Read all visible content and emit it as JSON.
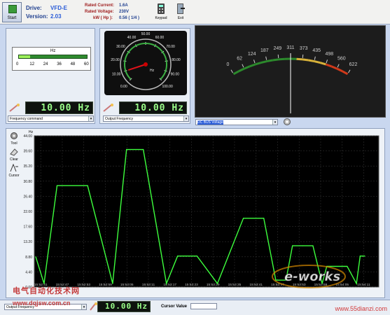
{
  "toolbar": {
    "start_label": "Start",
    "drive_label": "Drive:",
    "drive_value": "VFD-E",
    "version_label": "Version:",
    "version_value": "2.03",
    "rated_current_label": "Rated Current:",
    "rated_current_value": "1.6A",
    "rated_voltage_label": "Rated Voltage:",
    "rated_voltage_value": "230V",
    "kw_label": "kW ( Hp ):",
    "kw_value": "0.56 ( 1/4 )",
    "keypad_label": "Keypad",
    "exit_label": "Exit"
  },
  "bar_meter": {
    "unit": "Hz",
    "ticks": [
      "0",
      "12",
      "24",
      "36",
      "48",
      "60"
    ],
    "lcd_value": "10.00 Hz",
    "combo_value": "Frequency command",
    "fill_fraction": 0.17
  },
  "dial_meter": {
    "unit": "Hz",
    "ticks": [
      "0.00",
      "10.00",
      "20.00",
      "30.00",
      "40.00",
      "50.00",
      "60.00",
      "70.00",
      "80.00",
      "90.00",
      "100.00"
    ],
    "lcd_value": "10.00 Hz",
    "combo_value": "Output Frequency",
    "needle_value": 10
  },
  "arc_meter": {
    "ticks": [
      "0",
      "62",
      "124",
      "187",
      "249",
      "311",
      "373",
      "435",
      "498",
      "560",
      "622"
    ],
    "combo_value": "DC BUS Voltage",
    "needle_value": 311
  },
  "side_tools": {
    "tool_label": "Tool",
    "clear_label": "Clear",
    "cursor_label": "Cursor"
  },
  "trend_chart": {
    "y_unit": "Hz",
    "y_ticks": [
      "44.00",
      "39.60",
      "35.20",
      "30.80",
      "26.40",
      "22.00",
      "17.60",
      "13.20",
      "8.80",
      "4.40",
      "0.00"
    ],
    "x_ticks": [
      "15:52:41",
      "15:52:47",
      "15:52:53",
      "15:52:59",
      "15:53:05",
      "15:53:11",
      "15:53:17",
      "15:53:23",
      "15:53:29",
      "15:53:35",
      "15:53:41",
      "15:53:47",
      "15:53:53",
      "15:53:59",
      "15:54:05",
      "15:54:11"
    ]
  },
  "chart_data": {
    "type": "line",
    "ylabel": "Hz",
    "ylim": [
      0,
      44
    ],
    "x": [
      0.0,
      0.9,
      2.3,
      5.6,
      8.3,
      9.8,
      11.6,
      14.1,
      15.3,
      16.1,
      17.4,
      19.6,
      22.4,
      24.6,
      25.9,
      27.0,
      27.7,
      28.8,
      29.9,
      30.9,
      31.4,
      31.8,
      32.6,
      33.6,
      34.6,
      35.0,
      35.5
    ],
    "y": [
      8.8,
      1.0,
      29.5,
      29.5,
      1.0,
      40.0,
      40.0,
      1.0,
      9.0,
      9.0,
      9.0,
      1.0,
      20.0,
      20.0,
      2.0,
      2.0,
      12.0,
      12.0,
      12.0,
      1.0,
      6.0,
      6.0,
      6.0,
      6.0,
      1.0,
      9.0,
      9.0
    ],
    "x_labels": [
      "15:52:41",
      "15:52:47",
      "15:52:53",
      "15:52:59",
      "15:53:05",
      "15:53:11",
      "15:53:17",
      "15:53:23",
      "15:53:29",
      "15:53:35",
      "15:53:41",
      "15:53:47",
      "15:53:53",
      "15:53:59",
      "15:54:05",
      "15:54:11"
    ],
    "grid": true,
    "background": "#000000",
    "line_color": "#3dff3d"
  },
  "footer": {
    "combo_value": "Output Frequency",
    "lcd_value": "10.00 Hz",
    "cursor_label": "Cursor Value",
    "cursor_value": "",
    "cn_title": "电气自动化技术网",
    "cn_url": "www.dqjsw.com.cn",
    "url_right": "www.55dianzi.com",
    "eworks_logo": "e-works"
  }
}
